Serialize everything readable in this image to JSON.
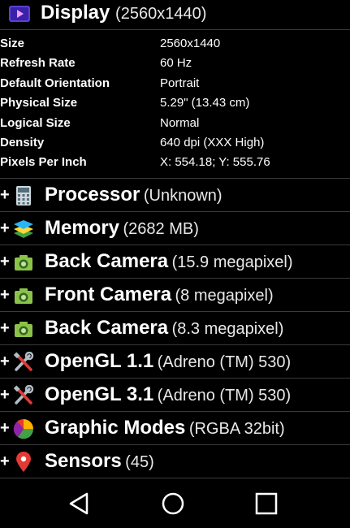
{
  "display": {
    "title": "Display",
    "subtitle": "(2560x1440)",
    "icon": "display-play-icon",
    "properties": [
      {
        "key": "Size",
        "value": "2560x1440"
      },
      {
        "key": "Refresh Rate",
        "value": "60 Hz"
      },
      {
        "key": "Default Orientation",
        "value": "Portrait"
      },
      {
        "key": "Physical Size",
        "value": "5.29\" (13.43 cm)"
      },
      {
        "key": "Logical Size",
        "value": "Normal"
      },
      {
        "key": "Density",
        "value": "640 dpi (XXX High)"
      },
      {
        "key": "Pixels Per Inch",
        "value": "X: 554.18; Y: 555.76"
      }
    ]
  },
  "sections": [
    {
      "title": "Processor",
      "sub": "(Unknown)",
      "icon": "calculator-icon",
      "expand": "+"
    },
    {
      "title": "Memory",
      "sub": "(2682 MB)",
      "icon": "layers-icon",
      "expand": "+"
    },
    {
      "title": "Back Camera",
      "sub": "(15.9 megapixel)",
      "icon": "camera-icon",
      "expand": "+"
    },
    {
      "title": "Front Camera",
      "sub": "(8 megapixel)",
      "icon": "camera-icon",
      "expand": "+"
    },
    {
      "title": "Back Camera",
      "sub": "(8.3 megapixel)",
      "icon": "camera-icon",
      "expand": "+"
    },
    {
      "title": "OpenGL 1.1",
      "sub": "(Adreno (TM) 530)",
      "icon": "tools-icon",
      "expand": "+"
    },
    {
      "title": "OpenGL 3.1",
      "sub": "(Adreno (TM) 530)",
      "icon": "tools-icon",
      "expand": "+"
    },
    {
      "title": "Graphic Modes",
      "sub": "(RGBA 32bit)",
      "icon": "pie-chart-icon",
      "expand": "+"
    },
    {
      "title": "Sensors",
      "sub": "(45)",
      "icon": "location-pin-icon",
      "expand": "+"
    }
  ],
  "colors": {
    "background": "#000000",
    "divider": "#3a3a3a",
    "camera": "#8bc34a",
    "pin": "#e53935",
    "display_icon": "#5c3fd6"
  },
  "navbar": {
    "buttons": [
      "back",
      "home",
      "recents"
    ]
  }
}
